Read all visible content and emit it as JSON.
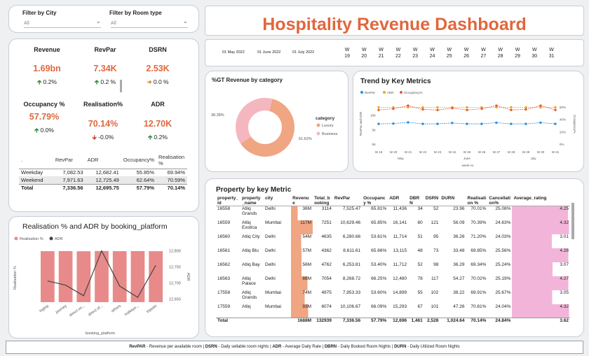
{
  "filters": {
    "city_label": "Filter by City",
    "city_value": "All",
    "room_label": "Filter by Room type",
    "room_value": "All"
  },
  "title": "Hospitality Revenue Dashboard",
  "dates": [
    "01 May 2022",
    "01 June 2022",
    "01 July 2022"
  ],
  "weeks": [
    "19",
    "20",
    "21",
    "22",
    "23",
    "24",
    "25",
    "26",
    "27",
    "28",
    "29",
    "30",
    "31"
  ],
  "week_prefix": "W",
  "kpis": [
    {
      "label": "Revenue",
      "value": "1.69bn",
      "arrow": "up",
      "delta": "0.2%"
    },
    {
      "label": "RevPar",
      "value": "7.34K",
      "arrow": "up",
      "delta": "0.2 %"
    },
    {
      "label": "DSRN",
      "value": "2.53K",
      "arrow": "flat",
      "delta": "0.0 %"
    },
    {
      "label": "Occupancy %",
      "value": "57.79%",
      "arrow": "up",
      "delta": "0.0%"
    },
    {
      "label": "Realisation%",
      "value": "70.14%",
      "arrow": "down",
      "delta": "-0.0%"
    },
    {
      "label": "ADR",
      "value": "12.70K",
      "arrow": "up",
      "delta": "0.2%"
    }
  ],
  "day_table": {
    "headers": [
      ".",
      "RevPar",
      "ADR",
      "Occupancy%",
      "Realisation %"
    ],
    "rows": [
      [
        "Weekday",
        "7,082.53",
        "12,682.41",
        "55.85%",
        "69.94%"
      ],
      [
        "Weekend",
        "7,971.63",
        "12,725.49",
        "62.64%",
        "70.59%"
      ],
      [
        "Total",
        "7,336.56",
        "12,695.75",
        "57.79%",
        "70.14%"
      ]
    ]
  },
  "booking_chart_title": "Realisation % and ADR by booking_platform",
  "gt_chart_title": "%GT Revenue by category",
  "trend_chart_title": "Trend by Key Metrics",
  "property_table": {
    "title": "Property by key Metric",
    "headers": [
      "property_id",
      "property_name",
      "city",
      "Revenue",
      "Total_booking",
      "RevPar",
      "Occupancy %",
      "ADR",
      "DBRN",
      "DSRN",
      "DURN",
      "Realisation %",
      "Cancellation%",
      "Average_rating"
    ],
    "rows": [
      [
        "16558",
        "Atliq Grands",
        "Delhi",
        "36M",
        "3114",
        "7,525.47",
        "65.81%",
        "11,436",
        "34",
        "52",
        "23.96",
        "70.01%",
        "25.08%",
        "4.25"
      ],
      [
        "16559",
        "Atliq Exotica",
        "Mumbai",
        "117M",
        "7251",
        "10,629.46",
        "65.85%",
        "16,141",
        "80",
        "121",
        "56.09",
        "70.39%",
        "24.63%",
        "4.32"
      ],
      [
        "16560",
        "Atliq City",
        "Delhi",
        "54M",
        "4635",
        "6,280.66",
        "53.61%",
        "11,714",
        "51",
        "95",
        "36.26",
        "71.20%",
        "24.03%",
        "3.01"
      ],
      [
        "16561",
        "Atliq Blu",
        "Delhi",
        "57M",
        "4362",
        "8,611.61",
        "65.66%",
        "13,115",
        "48",
        "73",
        "33.48",
        "69.85%",
        "25.56%",
        "4.28"
      ],
      [
        "16562",
        "Atliq Bay",
        "Delhi",
        "56M",
        "4762",
        "6,253.81",
        "53.40%",
        "11,712",
        "52",
        "98",
        "36.29",
        "69.34%",
        "25.24%",
        "3.07"
      ],
      [
        "16563",
        "Atliq Palace",
        "Delhi",
        "88M",
        "7054",
        "8,268.72",
        "66.25%",
        "12,480",
        "78",
        "117",
        "54.27",
        "70.02%",
        "25.19%",
        "4.27"
      ],
      [
        "17558",
        "Atliq Grands",
        "Mumbai",
        "74M",
        "4975",
        "7,953.33",
        "53.60%",
        "14,899",
        "55",
        "102",
        "38.22",
        "69.91%",
        "25.67%",
        "3.05"
      ],
      [
        "17559",
        "Atliq",
        "Mumbai",
        "93M",
        "6074",
        "10,106.67",
        "66.09%",
        "15,293",
        "67",
        "101",
        "47.26",
        "70.81%",
        "24.04%",
        "4.32"
      ]
    ],
    "total": [
      "Total",
      "",
      "",
      "1688M",
      "132939",
      "7,336.56",
      "57.79%",
      "12,696",
      "1,461",
      "2,528",
      "1,024.64",
      "70.14%",
      "24.84%",
      "3.62"
    ]
  },
  "footer": {
    "parts": [
      {
        "abbr": "RevPAR",
        "desc": " - Revenue per available room | "
      },
      {
        "abbr": "DSRN",
        "desc": " - Daily sellable room nights | "
      },
      {
        "abbr": "ADR",
        "desc": " - Average Daily Rate | "
      },
      {
        "abbr": "DBRN",
        "desc": " - Daily Booked Room Nights | "
      },
      {
        "abbr": "DURN",
        "desc": " - Daily Utilized Room Nights"
      }
    ]
  },
  "colors": {
    "accent": "#e0673d",
    "bar": "#e88a8a",
    "luxury": "#f0a583",
    "business": "#f4b7bf",
    "rating": "#f2b5d9"
  },
  "chart_data": [
    {
      "type": "bar",
      "title": "Realisation % and ADR by booking_platform",
      "xlabel": "booking_platform",
      "ylabel": "Realisation %",
      "y2label": "ADR",
      "categories": [
        "logtrip",
        "journey",
        "direct on...",
        "direct of...",
        "others",
        "makeyo...",
        "tripster"
      ],
      "series": [
        {
          "name": "Realisation %",
          "type": "bar",
          "values": [
            70.1,
            70.2,
            70.0,
            70.3,
            70.1,
            70.2,
            70.1
          ]
        },
        {
          "name": "ADR",
          "type": "line",
          "values": [
            12706,
            12693,
            12660,
            12800,
            12690,
            12655,
            12755
          ]
        }
      ],
      "y2ticks": [
        "12,650",
        "12,700",
        "12,750",
        "12,800"
      ],
      "legend": "top-left"
    },
    {
      "type": "pie",
      "title": "%GT Revenue by category",
      "legend_title": "category",
      "categories": [
        "Luxury",
        "Business"
      ],
      "values": [
        61.62,
        38.38
      ],
      "labels": [
        "61.62%",
        "38.38%"
      ]
    },
    {
      "type": "line",
      "title": "Trend by Key Metrics",
      "xlabel": "week no",
      "ylabel": "RevPar and ADR",
      "y2label": "Occupancy%",
      "x": [
        "W 19",
        "W 20",
        "W 21",
        "W 22",
        "W 23",
        "W 24",
        "W 25",
        "W 26",
        "W 27",
        "W 28",
        "W 29",
        "W 30",
        "W 31"
      ],
      "months": [
        "May",
        "June",
        "July"
      ],
      "yticks": [
        "0K",
        "5K",
        "10K"
      ],
      "y2ticks": [
        "0%",
        "20%",
        "40%",
        "60%"
      ],
      "series": [
        {
          "name": "RevPar",
          "values": [
            7000,
            7100,
            7500,
            7000,
            7000,
            7300,
            7000,
            7000,
            7400,
            7000,
            7000,
            7400,
            7000
          ]
        },
        {
          "name": "ADR",
          "values": [
            12700,
            12700,
            12700,
            12700,
            12700,
            12700,
            12700,
            12700,
            12700,
            12700,
            12700,
            12700,
            12700
          ]
        },
        {
          "name": "Occupancy%",
          "values": [
            55,
            57,
            62,
            56,
            55,
            58,
            55,
            57,
            62,
            55,
            56,
            62,
            55
          ]
        }
      ]
    }
  ]
}
